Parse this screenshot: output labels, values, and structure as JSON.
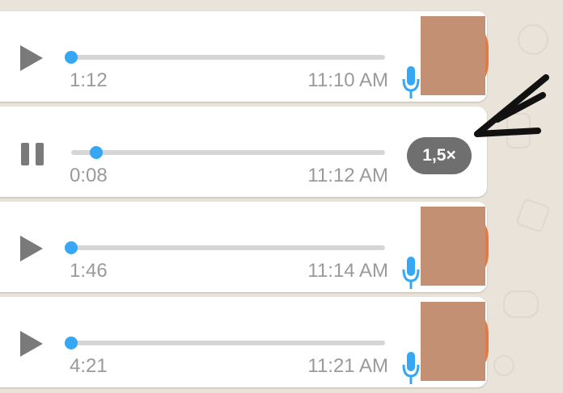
{
  "colors": {
    "accent_knob": "#35a7f4",
    "bubble": "#ffffff",
    "wallpaper": "#e9e3da",
    "control": "#7a7a7a",
    "meta_text": "#9a9a9a",
    "speed_pill": "#6f6f6f",
    "mic": "#35a7f4"
  },
  "messages": [
    {
      "state": "paused",
      "duration": "1:12",
      "time": "11:10 AM",
      "progress": 0.0,
      "side_icon": "mic-icon"
    },
    {
      "state": "playing",
      "duration": "0:08",
      "time": "11:12 AM",
      "progress": 0.08,
      "speed_label": "1,5×"
    },
    {
      "state": "paused",
      "duration": "1:46",
      "time": "11:14 AM",
      "progress": 0.0,
      "side_icon": "mic-icon"
    },
    {
      "state": "paused",
      "duration": "4:21",
      "time": "11:21 AM",
      "progress": 0.0,
      "side_icon": "mic-icon"
    }
  ]
}
